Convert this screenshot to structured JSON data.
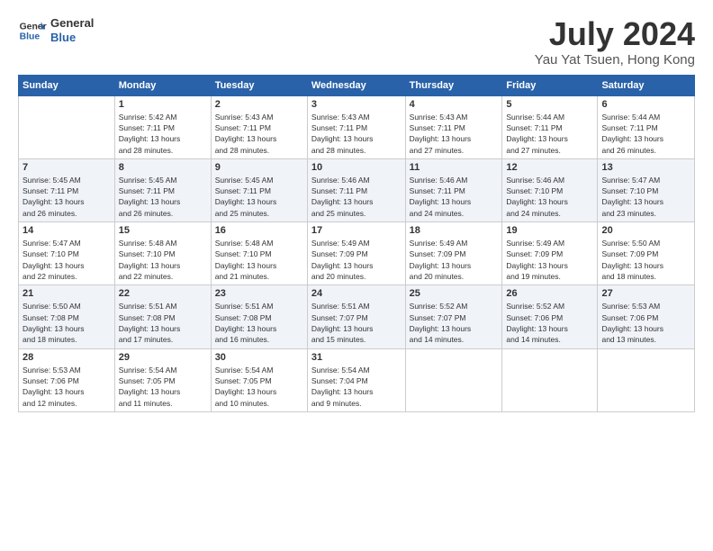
{
  "header": {
    "logo_line1": "General",
    "logo_line2": "Blue",
    "month": "July 2024",
    "location": "Yau Yat Tsuen, Hong Kong"
  },
  "weekdays": [
    "Sunday",
    "Monday",
    "Tuesday",
    "Wednesday",
    "Thursday",
    "Friday",
    "Saturday"
  ],
  "weeks": [
    [
      {
        "day": "",
        "info": ""
      },
      {
        "day": "1",
        "info": "Sunrise: 5:42 AM\nSunset: 7:11 PM\nDaylight: 13 hours\nand 28 minutes."
      },
      {
        "day": "2",
        "info": "Sunrise: 5:43 AM\nSunset: 7:11 PM\nDaylight: 13 hours\nand 28 minutes."
      },
      {
        "day": "3",
        "info": "Sunrise: 5:43 AM\nSunset: 7:11 PM\nDaylight: 13 hours\nand 28 minutes."
      },
      {
        "day": "4",
        "info": "Sunrise: 5:43 AM\nSunset: 7:11 PM\nDaylight: 13 hours\nand 27 minutes."
      },
      {
        "day": "5",
        "info": "Sunrise: 5:44 AM\nSunset: 7:11 PM\nDaylight: 13 hours\nand 27 minutes."
      },
      {
        "day": "6",
        "info": "Sunrise: 5:44 AM\nSunset: 7:11 PM\nDaylight: 13 hours\nand 26 minutes."
      }
    ],
    [
      {
        "day": "7",
        "info": "Sunrise: 5:45 AM\nSunset: 7:11 PM\nDaylight: 13 hours\nand 26 minutes."
      },
      {
        "day": "8",
        "info": "Sunrise: 5:45 AM\nSunset: 7:11 PM\nDaylight: 13 hours\nand 26 minutes."
      },
      {
        "day": "9",
        "info": "Sunrise: 5:45 AM\nSunset: 7:11 PM\nDaylight: 13 hours\nand 25 minutes."
      },
      {
        "day": "10",
        "info": "Sunrise: 5:46 AM\nSunset: 7:11 PM\nDaylight: 13 hours\nand 25 minutes."
      },
      {
        "day": "11",
        "info": "Sunrise: 5:46 AM\nSunset: 7:11 PM\nDaylight: 13 hours\nand 24 minutes."
      },
      {
        "day": "12",
        "info": "Sunrise: 5:46 AM\nSunset: 7:10 PM\nDaylight: 13 hours\nand 24 minutes."
      },
      {
        "day": "13",
        "info": "Sunrise: 5:47 AM\nSunset: 7:10 PM\nDaylight: 13 hours\nand 23 minutes."
      }
    ],
    [
      {
        "day": "14",
        "info": "Sunrise: 5:47 AM\nSunset: 7:10 PM\nDaylight: 13 hours\nand 22 minutes."
      },
      {
        "day": "15",
        "info": "Sunrise: 5:48 AM\nSunset: 7:10 PM\nDaylight: 13 hours\nand 22 minutes."
      },
      {
        "day": "16",
        "info": "Sunrise: 5:48 AM\nSunset: 7:10 PM\nDaylight: 13 hours\nand 21 minutes."
      },
      {
        "day": "17",
        "info": "Sunrise: 5:49 AM\nSunset: 7:09 PM\nDaylight: 13 hours\nand 20 minutes."
      },
      {
        "day": "18",
        "info": "Sunrise: 5:49 AM\nSunset: 7:09 PM\nDaylight: 13 hours\nand 20 minutes."
      },
      {
        "day": "19",
        "info": "Sunrise: 5:49 AM\nSunset: 7:09 PM\nDaylight: 13 hours\nand 19 minutes."
      },
      {
        "day": "20",
        "info": "Sunrise: 5:50 AM\nSunset: 7:09 PM\nDaylight: 13 hours\nand 18 minutes."
      }
    ],
    [
      {
        "day": "21",
        "info": "Sunrise: 5:50 AM\nSunset: 7:08 PM\nDaylight: 13 hours\nand 18 minutes."
      },
      {
        "day": "22",
        "info": "Sunrise: 5:51 AM\nSunset: 7:08 PM\nDaylight: 13 hours\nand 17 minutes."
      },
      {
        "day": "23",
        "info": "Sunrise: 5:51 AM\nSunset: 7:08 PM\nDaylight: 13 hours\nand 16 minutes."
      },
      {
        "day": "24",
        "info": "Sunrise: 5:51 AM\nSunset: 7:07 PM\nDaylight: 13 hours\nand 15 minutes."
      },
      {
        "day": "25",
        "info": "Sunrise: 5:52 AM\nSunset: 7:07 PM\nDaylight: 13 hours\nand 14 minutes."
      },
      {
        "day": "26",
        "info": "Sunrise: 5:52 AM\nSunset: 7:06 PM\nDaylight: 13 hours\nand 14 minutes."
      },
      {
        "day": "27",
        "info": "Sunrise: 5:53 AM\nSunset: 7:06 PM\nDaylight: 13 hours\nand 13 minutes."
      }
    ],
    [
      {
        "day": "28",
        "info": "Sunrise: 5:53 AM\nSunset: 7:06 PM\nDaylight: 13 hours\nand 12 minutes."
      },
      {
        "day": "29",
        "info": "Sunrise: 5:54 AM\nSunset: 7:05 PM\nDaylight: 13 hours\nand 11 minutes."
      },
      {
        "day": "30",
        "info": "Sunrise: 5:54 AM\nSunset: 7:05 PM\nDaylight: 13 hours\nand 10 minutes."
      },
      {
        "day": "31",
        "info": "Sunrise: 5:54 AM\nSunset: 7:04 PM\nDaylight: 13 hours\nand 9 minutes."
      },
      {
        "day": "",
        "info": ""
      },
      {
        "day": "",
        "info": ""
      },
      {
        "day": "",
        "info": ""
      }
    ]
  ]
}
